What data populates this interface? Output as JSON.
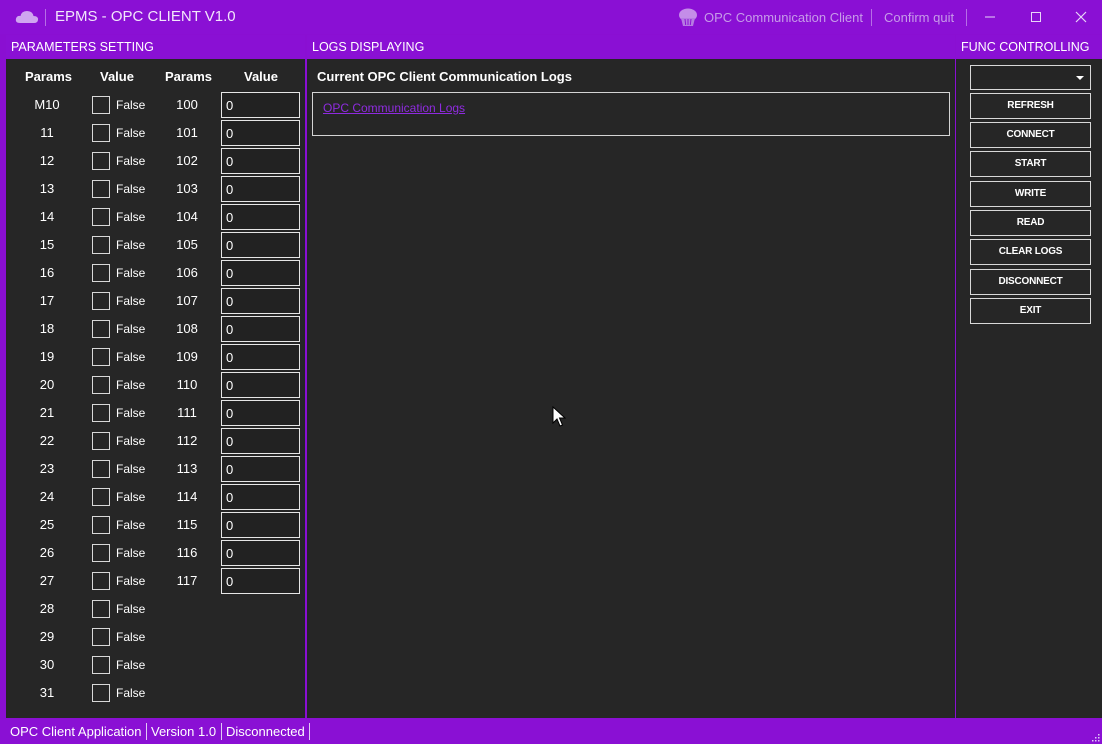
{
  "titlebar": {
    "app_icon": "cloud-icon",
    "title": "EPMS - OPC CLIENT V1.0",
    "right_icon": "cupcake-icon",
    "right_label": "OPC Communication Client",
    "confirm_label": "Confirm quit",
    "minimize": "—",
    "maximize": "☐",
    "close": "✕"
  },
  "params_panel": {
    "header": "PARAMETERS SETTING",
    "col_params_1": "Params",
    "col_value_1": "Value",
    "col_params_2": "Params",
    "col_value_2": "Value",
    "bool_rows": [
      {
        "name": "M10",
        "label": "False"
      },
      {
        "name": "11",
        "label": "False"
      },
      {
        "name": "12",
        "label": "False"
      },
      {
        "name": "13",
        "label": "False"
      },
      {
        "name": "14",
        "label": "False"
      },
      {
        "name": "15",
        "label": "False"
      },
      {
        "name": "16",
        "label": "False"
      },
      {
        "name": "17",
        "label": "False"
      },
      {
        "name": "18",
        "label": "False"
      },
      {
        "name": "19",
        "label": "False"
      },
      {
        "name": "20",
        "label": "False"
      },
      {
        "name": "21",
        "label": "False"
      },
      {
        "name": "22",
        "label": "False"
      },
      {
        "name": "23",
        "label": "False"
      },
      {
        "name": "24",
        "label": "False"
      },
      {
        "name": "25",
        "label": "False"
      },
      {
        "name": "26",
        "label": "False"
      },
      {
        "name": "27",
        "label": "False"
      },
      {
        "name": "28",
        "label": "False"
      },
      {
        "name": "29",
        "label": "False"
      },
      {
        "name": "30",
        "label": "False"
      },
      {
        "name": "31",
        "label": "False"
      }
    ],
    "num_rows": [
      {
        "name": "100",
        "value": "0"
      },
      {
        "name": "101",
        "value": "0"
      },
      {
        "name": "102",
        "value": "0"
      },
      {
        "name": "103",
        "value": "0"
      },
      {
        "name": "104",
        "value": "0"
      },
      {
        "name": "105",
        "value": "0"
      },
      {
        "name": "106",
        "value": "0"
      },
      {
        "name": "107",
        "value": "0"
      },
      {
        "name": "108",
        "value": "0"
      },
      {
        "name": "109",
        "value": "0"
      },
      {
        "name": "110",
        "value": "0"
      },
      {
        "name": "111",
        "value": "0"
      },
      {
        "name": "112",
        "value": "0"
      },
      {
        "name": "113",
        "value": "0"
      },
      {
        "name": "114",
        "value": "0"
      },
      {
        "name": "115",
        "value": "0"
      },
      {
        "name": "116",
        "value": "0"
      },
      {
        "name": "117",
        "value": "0"
      }
    ]
  },
  "logs_panel": {
    "header": "LOGS DISPLAYING",
    "title": "Current OPC Client Communication Logs",
    "link": "OPC Communication Logs"
  },
  "func_panel": {
    "header": "FUNC CONTROLLING",
    "combo_value": "",
    "buttons": [
      "REFRESH",
      "CONNECT",
      "START",
      "WRITE",
      "READ",
      "CLEAR LOGS",
      "DISCONNECT",
      "EXIT"
    ]
  },
  "statusbar": {
    "app": "OPC Client Application",
    "version": "Version 1.0",
    "status": "Disconnected"
  },
  "colors": {
    "accent": "#8a10d4",
    "panel_bg": "#262626",
    "link": "#8f2be0"
  }
}
